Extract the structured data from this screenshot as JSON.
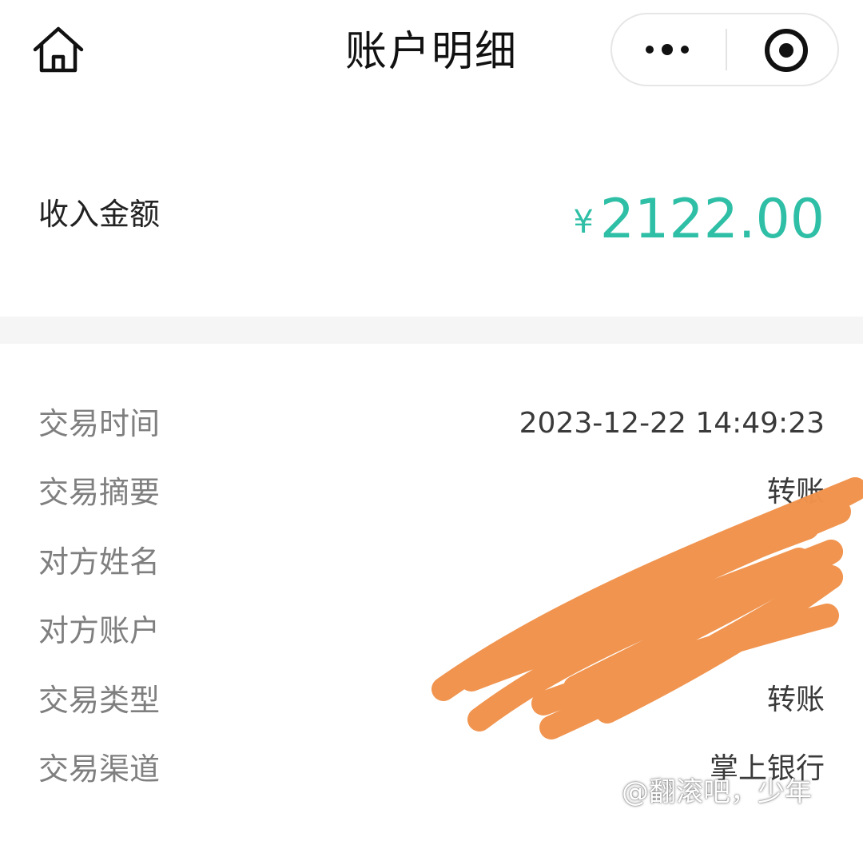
{
  "header": {
    "title": "账户明细",
    "home_icon": "home-icon",
    "more_icon": "more-dots-icon",
    "close_icon": "target-circle-icon"
  },
  "summary": {
    "label": "收入金额",
    "currency": "¥",
    "amount": "2122.00",
    "accent_color": "#2fbfa6"
  },
  "details": [
    {
      "label": "交易时间",
      "value": "2023-12-22 14:49:23"
    },
    {
      "label": "交易摘要",
      "value": "转账"
    },
    {
      "label": "对方姓名",
      "value": ""
    },
    {
      "label": "对方账户",
      "value": ""
    },
    {
      "label": "交易类型",
      "value": "转账"
    },
    {
      "label": "交易渠道",
      "value": "掌上银行"
    }
  ],
  "redaction_color": "#f0924c",
  "watermark": "@翻滚吧，少年"
}
